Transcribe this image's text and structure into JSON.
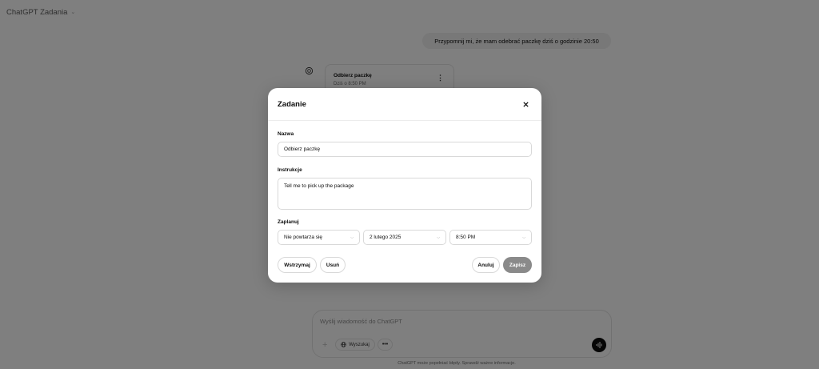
{
  "header": {
    "title": "ChatGPT Zadania"
  },
  "chat": {
    "user_message": "Przypomnij mi, że mam odebrać paczkę dziś o godzinie 20:50",
    "task_card": {
      "title": "Odbierz paczkę",
      "time": "Dziś o 8:50 PM"
    }
  },
  "composer": {
    "placeholder": "Wyślij wiadomość do ChatGPT",
    "search_label": "Wyszukaj",
    "more_label": "•••"
  },
  "footer": {
    "note": "ChatGPT może popełniać błędy. Sprawdź ważne informacje."
  },
  "modal": {
    "title": "Zadanie",
    "name_label": "Nazwa",
    "name_value": "Odbierz paczkę",
    "instructions_label": "Instrukcje",
    "instructions_value": "Tell me to pick up the package",
    "schedule_label": "Zaplanuj",
    "repeat_value": "Nie powtarza się",
    "date_value": "2 lutego 2025",
    "time_value": "8:50 PM",
    "pause_label": "Wstrzymaj",
    "delete_label": "Usuń",
    "cancel_label": "Anuluj",
    "save_label": "Zapisz"
  },
  "colors": {
    "overlay": "#000000",
    "save_button": "#8a8a8a",
    "voice_button": "#0d0d0d"
  }
}
